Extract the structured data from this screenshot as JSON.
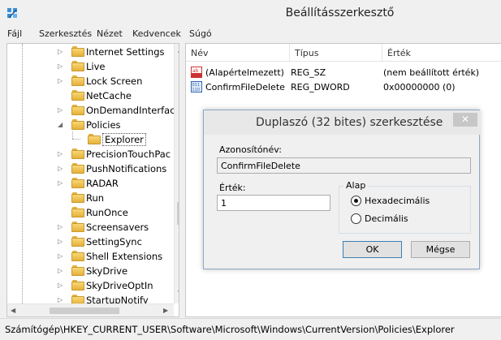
{
  "window": {
    "title": "Beállításszerkesztő",
    "icon": "regedit-icon"
  },
  "menu": [
    "Fájl",
    "Szerkesztés",
    "Nézet",
    "Kedvencek",
    "Súgó"
  ],
  "tree": {
    "items": [
      {
        "label": "Internet Settings",
        "expander": "▷",
        "depth": 1
      },
      {
        "label": "Live",
        "expander": "▷",
        "depth": 1
      },
      {
        "label": "Lock Screen",
        "expander": "▷",
        "depth": 1
      },
      {
        "label": "NetCache",
        "expander": "",
        "depth": 1
      },
      {
        "label": "OnDemandInterfac",
        "expander": "▷",
        "depth": 1
      },
      {
        "label": "Policies",
        "expander": "◢",
        "depth": 1
      },
      {
        "label": "Explorer",
        "expander": "",
        "depth": 2,
        "selected": true
      },
      {
        "label": "PrecisionTouchPac",
        "expander": "▷",
        "depth": 1
      },
      {
        "label": "PushNotifications",
        "expander": "▷",
        "depth": 1
      },
      {
        "label": "RADAR",
        "expander": "▷",
        "depth": 1
      },
      {
        "label": "Run",
        "expander": "",
        "depth": 1
      },
      {
        "label": "RunOnce",
        "expander": "",
        "depth": 1
      },
      {
        "label": "Screensavers",
        "expander": "▷",
        "depth": 1
      },
      {
        "label": "SettingSync",
        "expander": "▷",
        "depth": 1
      },
      {
        "label": "Shell Extensions",
        "expander": "▷",
        "depth": 1
      },
      {
        "label": "SkyDrive",
        "expander": "▷",
        "depth": 1
      },
      {
        "label": "SkyDriveOptIn",
        "expander": "▷",
        "depth": 1
      },
      {
        "label": "StartupNotify",
        "expander": "▷",
        "depth": 1
      }
    ]
  },
  "values": {
    "columns": [
      "Név",
      "Típus",
      "Érték"
    ],
    "rows": [
      {
        "icon": "string-value-icon",
        "name": "(Alapértelmezett)",
        "type": "REG_SZ",
        "data": "(nem beállított érték)"
      },
      {
        "icon": "dword-value-icon",
        "name": "ConfirmFileDelete",
        "type": "REG_DWORD",
        "data": "0x00000000 (0)"
      }
    ]
  },
  "status": {
    "path": "Számítógép\\HKEY_CURRENT_USER\\Software\\Microsoft\\Windows\\CurrentVersion\\Policies\\Explorer"
  },
  "dialog": {
    "title": "Duplaszó (32 bites) szerkesztése",
    "close": "✕",
    "name_label": "Azonosítónév:",
    "name_value": "ConfirmFileDelete",
    "value_label": "Érték:",
    "value_value": "1",
    "base_label": "Alap",
    "base_options": [
      {
        "label": "Hexadecimális",
        "checked": true
      },
      {
        "label": "Decimális",
        "checked": false
      }
    ],
    "ok_label": "OK",
    "cancel_label": "Mégse"
  },
  "colors": {
    "folder": "#e5b23b",
    "dialog_border": "#8fa8c6",
    "close_button": "#c7c7c7"
  }
}
